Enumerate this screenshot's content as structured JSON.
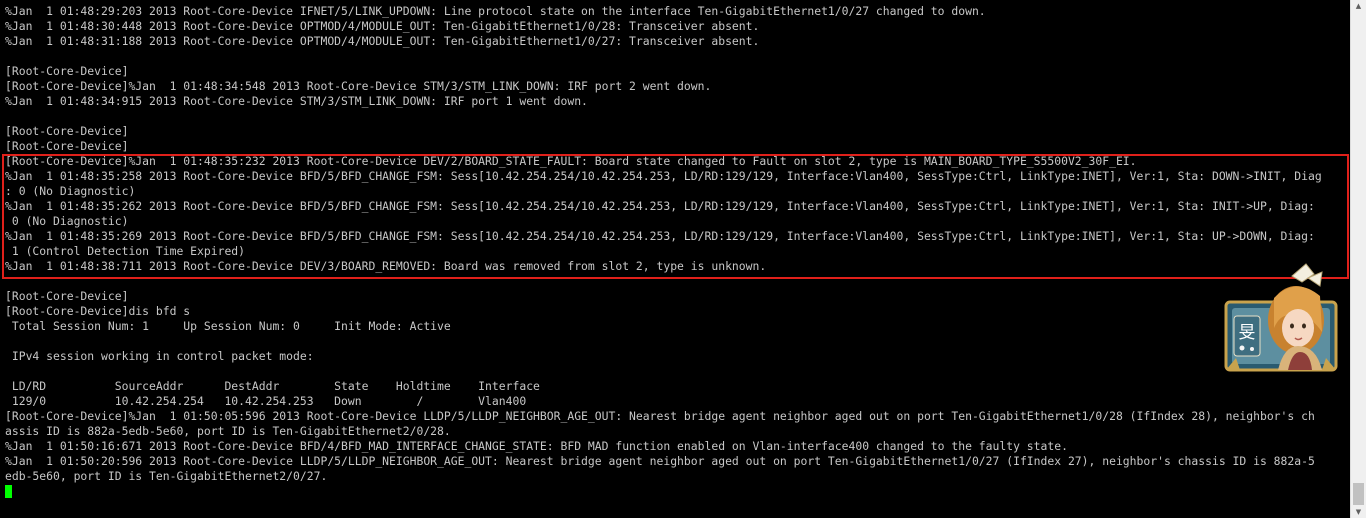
{
  "terminal": {
    "lines": [
      "%Jan  1 01:48:29:203 2013 Root-Core-Device IFNET/5/LINK_UPDOWN: Line protocol state on the interface Ten-GigabitEthernet1/0/27 changed to down.",
      "%Jan  1 01:48:30:448 2013 Root-Core-Device OPTMOD/4/MODULE_OUT: Ten-GigabitEthernet1/0/28: Transceiver absent.",
      "%Jan  1 01:48:31:188 2013 Root-Core-Device OPTMOD/4/MODULE_OUT: Ten-GigabitEthernet1/0/27: Transceiver absent.",
      "",
      "[Root-Core-Device]",
      "[Root-Core-Device]%Jan  1 01:48:34:548 2013 Root-Core-Device STM/3/STM_LINK_DOWN: IRF port 2 went down.",
      "%Jan  1 01:48:34:915 2013 Root-Core-Device STM/3/STM_LINK_DOWN: IRF port 1 went down.",
      "",
      "[Root-Core-Device]",
      "[Root-Core-Device]",
      "[Root-Core-Device]%Jan  1 01:48:35:232 2013 Root-Core-Device DEV/2/BOARD_STATE_FAULT: Board state changed to Fault on slot 2, type is MAIN_BOARD_TYPE_S5500V2_30F_EI.",
      "%Jan  1 01:48:35:258 2013 Root-Core-Device BFD/5/BFD_CHANGE_FSM: Sess[10.42.254.254/10.42.254.253, LD/RD:129/129, Interface:Vlan400, SessType:Ctrl, LinkType:INET], Ver:1, Sta: DOWN->INIT, Diag",
      ": 0 (No Diagnostic)",
      "%Jan  1 01:48:35:262 2013 Root-Core-Device BFD/5/BFD_CHANGE_FSM: Sess[10.42.254.254/10.42.254.253, LD/RD:129/129, Interface:Vlan400, SessType:Ctrl, LinkType:INET], Ver:1, Sta: INIT->UP, Diag:",
      " 0 (No Diagnostic)",
      "%Jan  1 01:48:35:269 2013 Root-Core-Device BFD/5/BFD_CHANGE_FSM: Sess[10.42.254.254/10.42.254.253, LD/RD:129/129, Interface:Vlan400, SessType:Ctrl, LinkType:INET], Ver:1, Sta: UP->DOWN, Diag:",
      " 1 (Control Detection Time Expired)",
      "%Jan  1 01:48:38:711 2013 Root-Core-Device DEV/3/BOARD_REMOVED: Board was removed from slot 2, type is unknown.",
      "",
      "[Root-Core-Device]",
      "[Root-Core-Device]dis bfd s",
      " Total Session Num: 1     Up Session Num: 0     Init Mode: Active",
      "",
      " IPv4 session working in control packet mode:",
      "",
      " LD/RD          SourceAddr      DestAddr        State    Holdtime    Interface",
      " 129/0          10.42.254.254   10.42.254.253   Down        /        Vlan400",
      "[Root-Core-Device]%Jan  1 01:50:05:596 2013 Root-Core-Device LLDP/5/LLDP_NEIGHBOR_AGE_OUT: Nearest bridge agent neighbor aged out on port Ten-GigabitEthernet1/0/28 (IfIndex 28), neighbor's ch",
      "assis ID is 882a-5edb-5e60, port ID is Ten-GigabitEthernet2/0/28.",
      "%Jan  1 01:50:16:671 2013 Root-Core-Device BFD/4/BFD_MAD_INTERFACE_CHANGE_STATE: BFD MAD function enabled on Vlan-interface400 changed to the faulty state.",
      "%Jan  1 01:50:20:596 2013 Root-Core-Device LLDP/5/LLDP_NEIGHBOR_AGE_OUT: Nearest bridge agent neighbor aged out on port Ten-GigabitEthernet1/0/27 (IfIndex 27), neighbor's chassis ID is 882a-5",
      "edb-5e60, port ID is Ten-GigabitEthernet2/0/27."
    ]
  },
  "colors": {
    "background": "#000000",
    "text": "#c7c7c7",
    "highlight_border": "#e0201a",
    "cursor": "#00ff00"
  },
  "avatar": {
    "glyph": "旻",
    "icon": "anime-avatar-icon"
  },
  "scrollbar": {
    "up_arrow": "▲",
    "down_arrow": "▼"
  }
}
